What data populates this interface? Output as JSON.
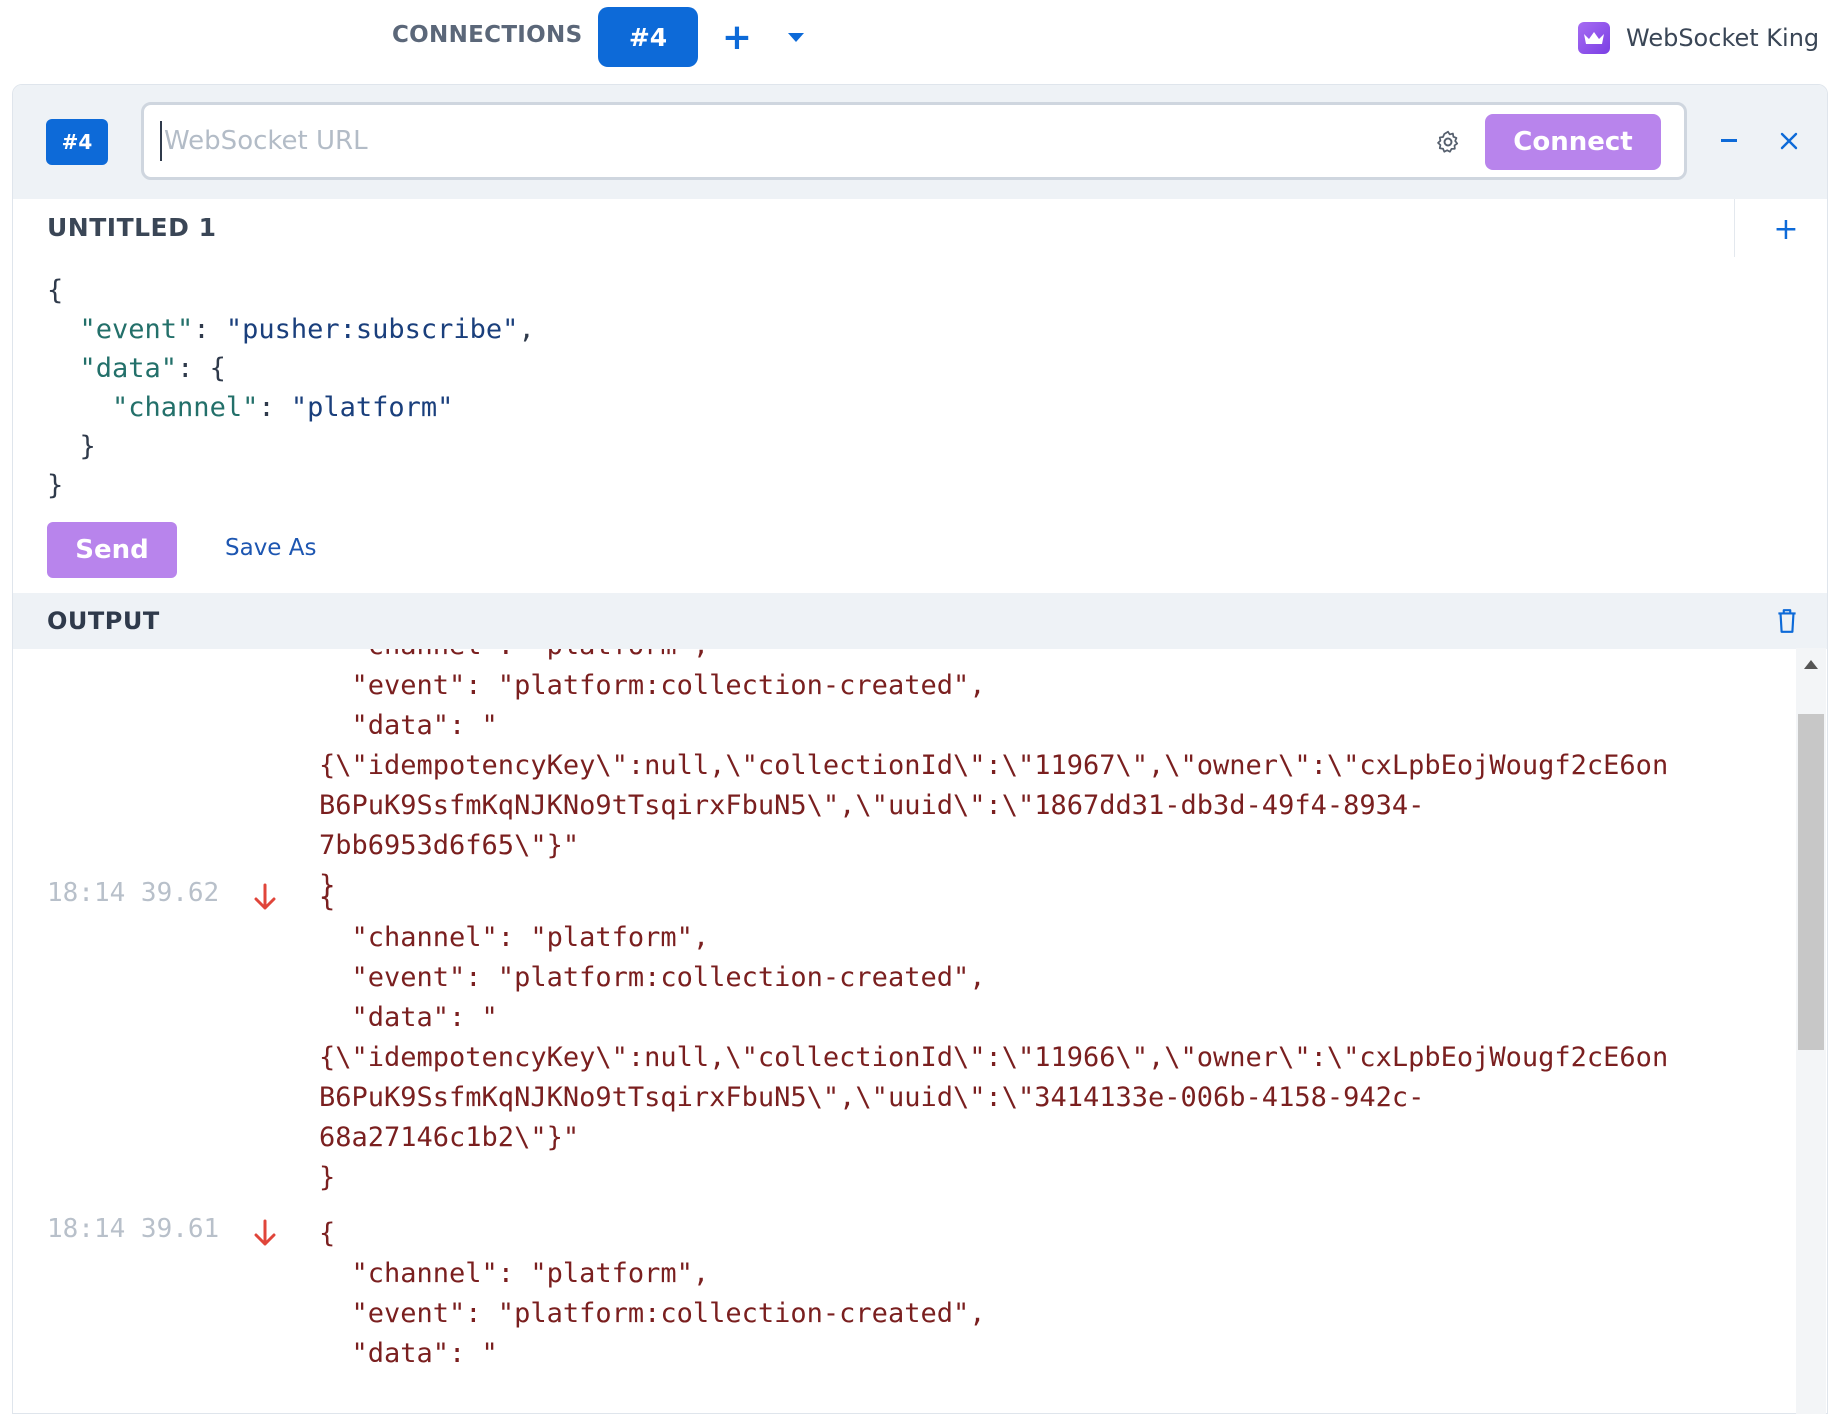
{
  "topbar": {
    "connections_label": "CONNECTIONS",
    "active_tab": "#4",
    "add_tab_symbol": "+",
    "dropdown_icon": "caret-down-icon",
    "brand_name": "WebSocket King",
    "brand_icon": "crown-icon",
    "accent_color": "#0d6ad8"
  },
  "connection": {
    "badge": "#4",
    "url_value": "",
    "url_placeholder": "WebSocket URL",
    "settings_icon": "gear-icon",
    "connect_label": "Connect",
    "connect_color": "#b884ec",
    "minimize_icon": "minus-icon",
    "close_icon": "close-icon"
  },
  "editor": {
    "title": "UNTITLED 1",
    "add_symbol": "+",
    "code_lines": [
      "{",
      "  \"event\": \"pusher:subscribe\",",
      "  \"data\": {",
      "    \"channel\": \"platform\"",
      "  }",
      "}"
    ],
    "send_label": "Send",
    "save_as_label": "Save As"
  },
  "output": {
    "title": "OUTPUT",
    "clear_icon": "trash-icon",
    "entries": [
      {
        "timestamp": "",
        "direction": "incoming",
        "lines": [
          "  \"channel\": \"platform\",",
          "  \"event\": \"platform:collection-created\",",
          "  \"data\": \"",
          "{\\\"idempotencyKey\\\":null,\\\"collectionId\\\":\\\"11967\\\",\\\"owner\\\":\\\"cxLpbEojWougf2cE6on",
          "B6PuK9SsfmKqNJKNo9tTsqirxFbuN5\\\",\\\"uuid\\\":\\\"1867dd31-db3d-49f4-8934-",
          "7bb6953d6f65\\\"}\"",
          "}"
        ]
      },
      {
        "timestamp": "18:14 39.62",
        "direction": "incoming",
        "lines": [
          "{",
          "  \"channel\": \"platform\",",
          "  \"event\": \"platform:collection-created\",",
          "  \"data\": \"",
          "{\\\"idempotencyKey\\\":null,\\\"collectionId\\\":\\\"11966\\\",\\\"owner\\\":\\\"cxLpbEojWougf2cE6on",
          "B6PuK9SsfmKqNJKNo9tTsqirxFbuN5\\\",\\\"uuid\\\":\\\"3414133e-006b-4158-942c-",
          "68a27146c1b2\\\"}\"",
          "}"
        ]
      },
      {
        "timestamp": "18:14 39.61",
        "direction": "incoming",
        "lines": [
          "{",
          "  \"channel\": \"platform\",",
          "  \"event\": \"platform:collection-created\",",
          "  \"data\": \""
        ]
      }
    ],
    "scrollbar_position": 0.1
  }
}
